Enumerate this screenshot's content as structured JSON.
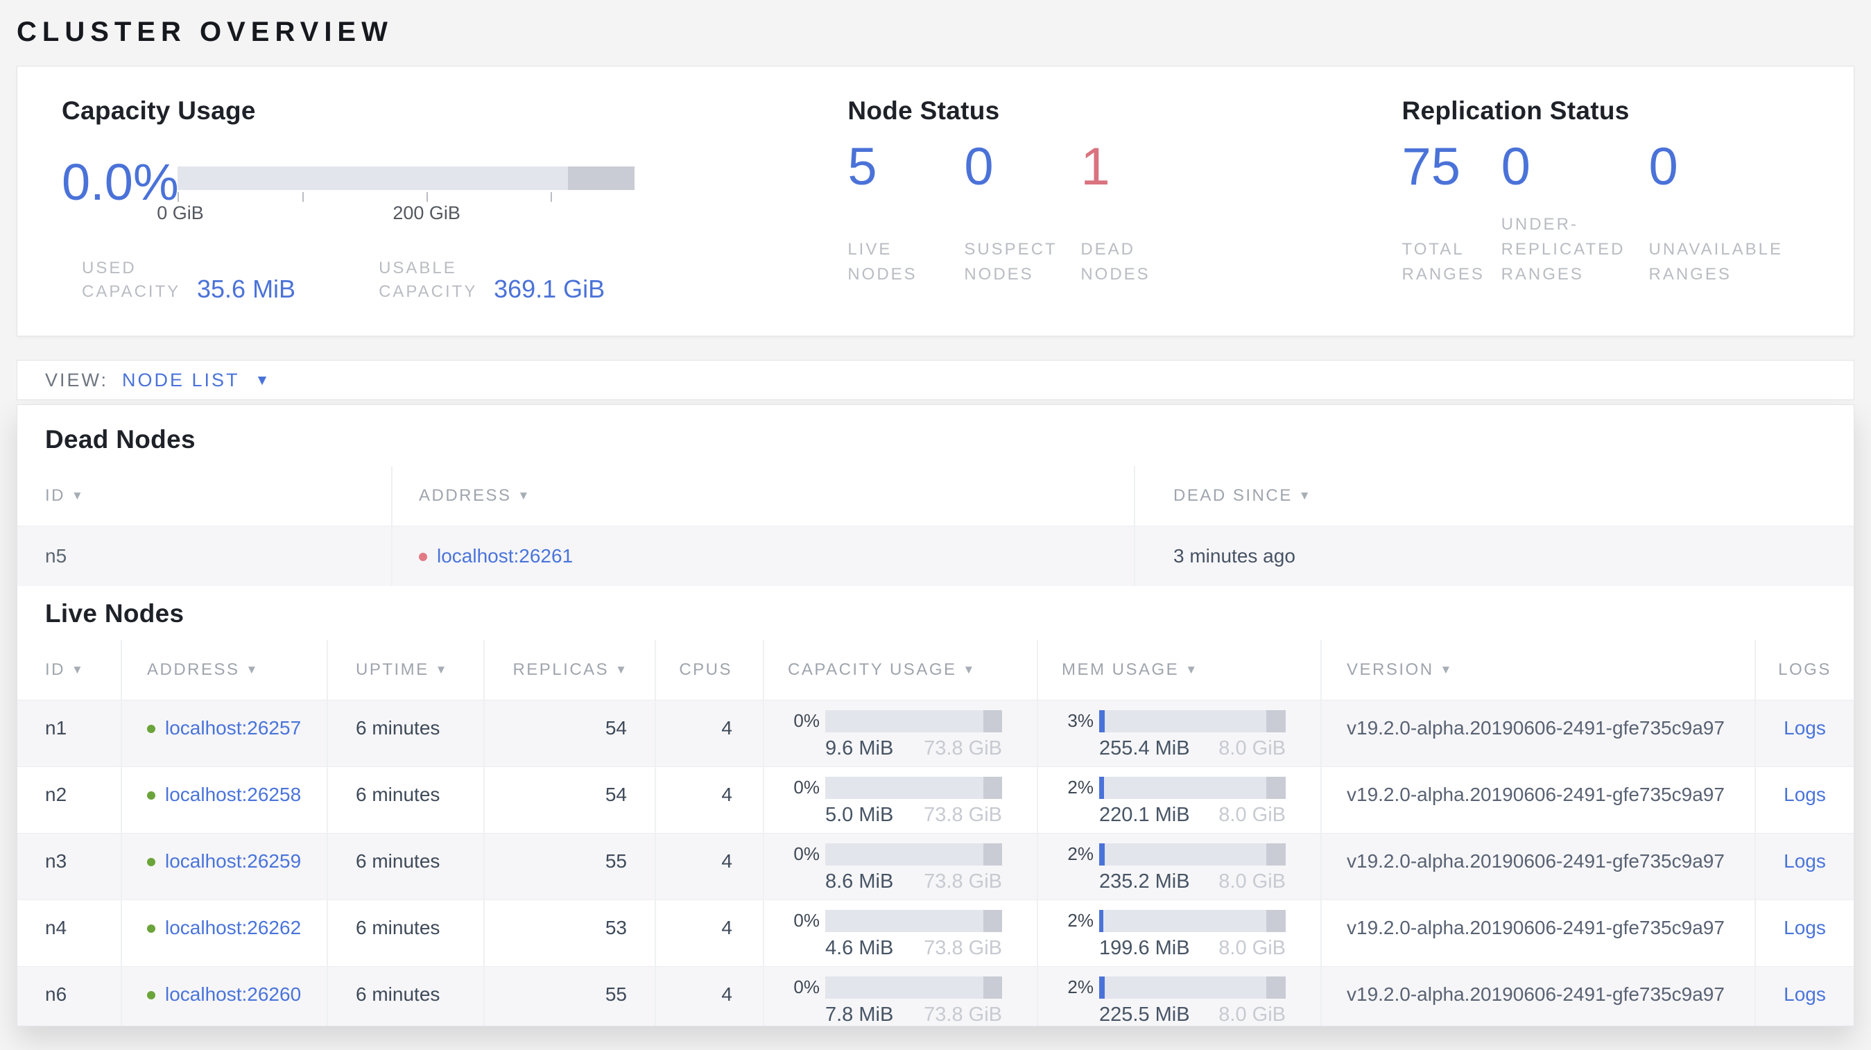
{
  "colors": {
    "accent_blue": "#4a72d8",
    "danger_red": "#d9737f",
    "link_blue": "#4a74da",
    "live_green": "#6ba43a",
    "dead_red": "#e17a85"
  },
  "icons": {
    "sort_arrow": "▼",
    "caret_down": "▼"
  },
  "page": {
    "title": "CLUSTER OVERVIEW"
  },
  "summary": {
    "capacity": {
      "title": "Capacity Usage",
      "percent": "0.0%",
      "fill_pct": 0,
      "used_label": "USED CAPACITY",
      "used_value": "35.6 MiB",
      "usable_label": "USABLE CAPACITY",
      "usable_value": "369.1 GiB",
      "tick_labels": {
        "first": "0 GiB",
        "third": "200 GiB"
      }
    },
    "node_status": {
      "title": "Node Status",
      "stats": [
        {
          "value": "5",
          "label": "LIVE NODES"
        },
        {
          "value": "0",
          "label": "SUSPECT NODES"
        },
        {
          "value": "1",
          "label": "DEAD NODES"
        }
      ]
    },
    "replication": {
      "title": "Replication Status",
      "stats": [
        {
          "value": "75",
          "label": "TOTAL RANGES"
        },
        {
          "value": "0",
          "label": "UNDER-REPLICATED RANGES"
        },
        {
          "value": "0",
          "label": "UNAVAILABLE RANGES"
        }
      ]
    }
  },
  "view_bar": {
    "label": "VIEW:",
    "selected": "NODE LIST"
  },
  "dead_nodes": {
    "title": "Dead Nodes",
    "columns": [
      "ID",
      "ADDRESS",
      "DEAD SINCE"
    ],
    "rows": [
      {
        "id": "n5",
        "address": "localhost:26261",
        "dead_since": "3 minutes ago"
      }
    ]
  },
  "live_nodes": {
    "title": "Live Nodes",
    "columns": [
      "ID",
      "ADDRESS",
      "UPTIME",
      "REPLICAS",
      "CPUS",
      "CAPACITY USAGE",
      "MEM USAGE",
      "VERSION",
      "LOGS"
    ],
    "rows": [
      {
        "id": "n1",
        "address": "localhost:26257",
        "uptime": "6 minutes",
        "replicas": "54",
        "cpus": "4",
        "capacity": {
          "percent": "0%",
          "fill_pct": 0,
          "used": "9.6 MiB",
          "total": "73.8 GiB"
        },
        "mem": {
          "percent": "3%",
          "fill_pct": 3,
          "used": "255.4 MiB",
          "total": "8.0 GiB"
        },
        "version": "v19.2.0-alpha.20190606-2491-gfe735c9a97",
        "logs": "Logs"
      },
      {
        "id": "n2",
        "address": "localhost:26258",
        "uptime": "6 minutes",
        "replicas": "54",
        "cpus": "4",
        "capacity": {
          "percent": "0%",
          "fill_pct": 0,
          "used": "5.0 MiB",
          "total": "73.8 GiB"
        },
        "mem": {
          "percent": "2%",
          "fill_pct": 2.7,
          "used": "220.1 MiB",
          "total": "8.0 GiB"
        },
        "version": "v19.2.0-alpha.20190606-2491-gfe735c9a97",
        "logs": "Logs"
      },
      {
        "id": "n3",
        "address": "localhost:26259",
        "uptime": "6 minutes",
        "replicas": "55",
        "cpus": "4",
        "capacity": {
          "percent": "0%",
          "fill_pct": 0,
          "used": "8.6 MiB",
          "total": "73.8 GiB"
        },
        "mem": {
          "percent": "2%",
          "fill_pct": 2.9,
          "used": "235.2 MiB",
          "total": "8.0 GiB"
        },
        "version": "v19.2.0-alpha.20190606-2491-gfe735c9a97",
        "logs": "Logs"
      },
      {
        "id": "n4",
        "address": "localhost:26262",
        "uptime": "6 minutes",
        "replicas": "53",
        "cpus": "4",
        "capacity": {
          "percent": "0%",
          "fill_pct": 0,
          "used": "4.6 MiB",
          "total": "73.8 GiB"
        },
        "mem": {
          "percent": "2%",
          "fill_pct": 2.4,
          "used": "199.6 MiB",
          "total": "8.0 GiB"
        },
        "version": "v19.2.0-alpha.20190606-2491-gfe735c9a97",
        "logs": "Logs"
      },
      {
        "id": "n6",
        "address": "localhost:26260",
        "uptime": "6 minutes",
        "replicas": "55",
        "cpus": "4",
        "capacity": {
          "percent": "0%",
          "fill_pct": 0,
          "used": "7.8 MiB",
          "total": "73.8 GiB"
        },
        "mem": {
          "percent": "2%",
          "fill_pct": 2.8,
          "used": "225.5 MiB",
          "total": "8.0 GiB"
        },
        "version": "v19.2.0-alpha.20190606-2491-gfe735c9a97",
        "logs": "Logs"
      }
    ]
  }
}
